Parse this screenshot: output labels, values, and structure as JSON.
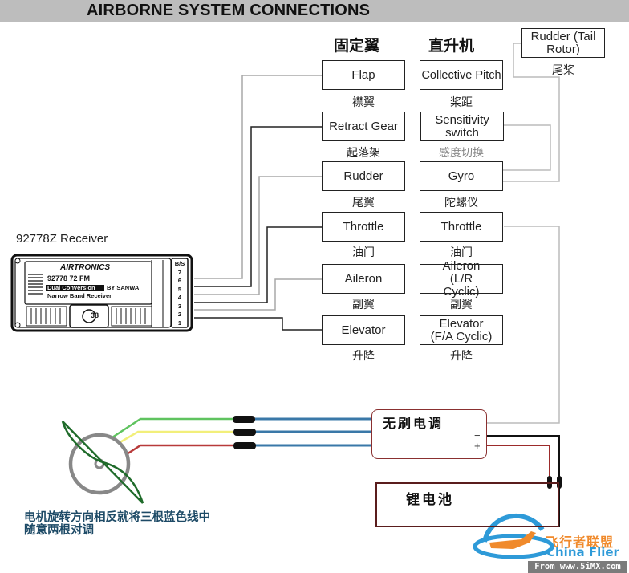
{
  "title": "AIRBORNE SYSTEM CONNECTIONS",
  "columns": {
    "fixed_wing": "固定翼",
    "helicopter": "直升机"
  },
  "receiver": {
    "label": "92778Z Receiver",
    "brand": "AIRTRONICS",
    "model": "92778 72 FM",
    "line1": "Dual Conversion",
    "by": "BY SANWA",
    "line2": "Narrow Band Receiver",
    "channel_badge": "38",
    "ports": [
      "B/S",
      "7",
      "6",
      "5",
      "4",
      "3",
      "2",
      "1"
    ]
  },
  "fixed_wing": [
    {
      "label": "Flap",
      "cn": "襟翼"
    },
    {
      "label": "Retract Gear",
      "cn": "起落架"
    },
    {
      "label": "Rudder",
      "cn": "尾翼"
    },
    {
      "label": "Throttle",
      "cn": "油门"
    },
    {
      "label": "Aileron",
      "cn": "副翼"
    },
    {
      "label": "Elevator",
      "cn": "升降"
    }
  ],
  "helicopter": [
    {
      "label": "Collective Pitch",
      "cn": "桨距"
    },
    {
      "label": "Sensitivity switch",
      "cn": "感度切换"
    },
    {
      "label": "Gyro",
      "cn": "陀螺仪"
    },
    {
      "label": "Throttle",
      "cn": "油门"
    },
    {
      "label": "Aileron (L/R Cyclic)",
      "cn": "副翼"
    },
    {
      "label": "Elevator (F/A Cyclic)",
      "cn": "升降"
    }
  ],
  "tail_rotor": {
    "label": "Rudder (Tail Rotor)",
    "cn": "尾桨"
  },
  "esc": {
    "label": "无刷电调",
    "minus": "−",
    "plus": "+"
  },
  "battery": {
    "label": "锂电池"
  },
  "motor_note": "电机旋转方向相反就将三根蓝色线中随意两根对调",
  "watermark": {
    "brand_cn": "飞行者联盟",
    "brand_en": "China Flier",
    "source": "From www.5iMX.com"
  },
  "colors": {
    "wire_gray": "#a8a8a8",
    "wire_black": "#222222",
    "blue_wire": "#3a78a8",
    "motor_green": "#5fc35f",
    "motor_yellow": "#f2ef7a",
    "motor_red": "#b83a3a",
    "propeller": "#1f6b2a",
    "esc_border": "#8a3030",
    "battery_border": "#5a1d1d"
  }
}
